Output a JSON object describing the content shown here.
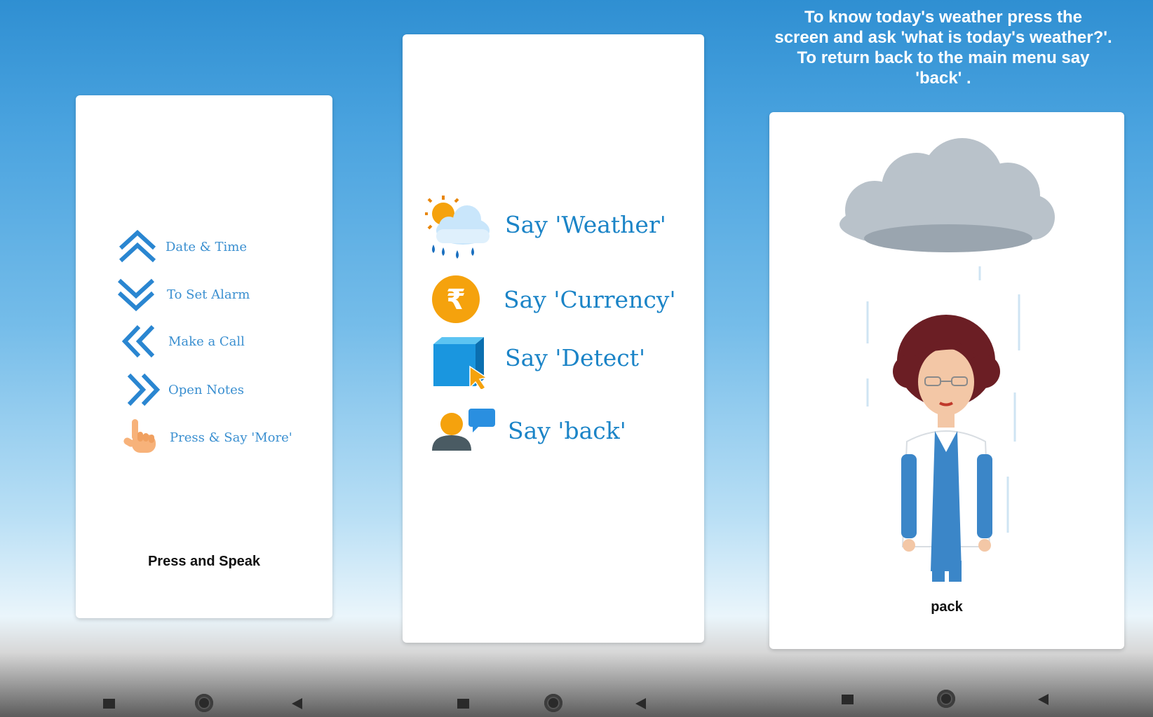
{
  "panel1": {
    "menu": [
      {
        "label": "Date & Time",
        "icon": "double-chevron-up-icon"
      },
      {
        "label": "To Set Alarm",
        "icon": "double-chevron-down-icon"
      },
      {
        "label": "Make a Call",
        "icon": "double-chevron-left-icon"
      },
      {
        "label": "Open Notes",
        "icon": "double-chevron-right-icon"
      },
      {
        "label": "Press & Say 'More'",
        "icon": "hand-tap-icon"
      }
    ],
    "action": "Press and Speak"
  },
  "panel2": {
    "options": [
      {
        "label": "Say 'Weather'",
        "icon": "weather-icon"
      },
      {
        "label": "Say 'Currency'",
        "icon": "rupee-coin-icon"
      },
      {
        "label": "Say 'Detect'",
        "icon": "cube-cursor-icon"
      },
      {
        "label": "Say 'back'",
        "icon": "person-chat-icon"
      }
    ]
  },
  "panel3": {
    "instruction_lines": [
      "To know today's weather press the",
      "screen and ask 'what is today's weather?'.",
      "To return back to the main menu say",
      "'back' ."
    ],
    "caption": "pack"
  },
  "colors": {
    "accent_blue": "#3a8fd0",
    "option_blue": "#1b84c7",
    "coin_orange": "#f5a20d",
    "sky_top": "#2f8fd2"
  }
}
